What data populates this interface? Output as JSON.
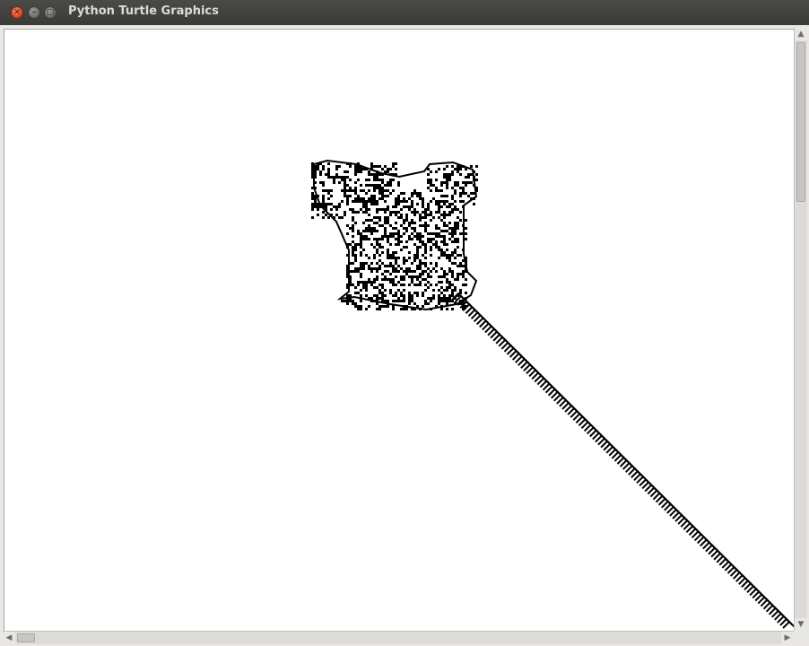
{
  "window": {
    "title": "Python Turtle Graphics",
    "controls": {
      "close_icon": "close-icon",
      "minimize_icon": "minimize-icon",
      "maximize_icon": "maximize-icon"
    }
  },
  "canvas": {
    "background": "#ffffff",
    "ink": "#000000"
  },
  "scrollbars": {
    "vertical": {
      "up_glyph": "▲",
      "down_glyph": "▼"
    },
    "horizontal": {
      "left_glyph": "◀",
      "right_glyph": "▶"
    }
  }
}
